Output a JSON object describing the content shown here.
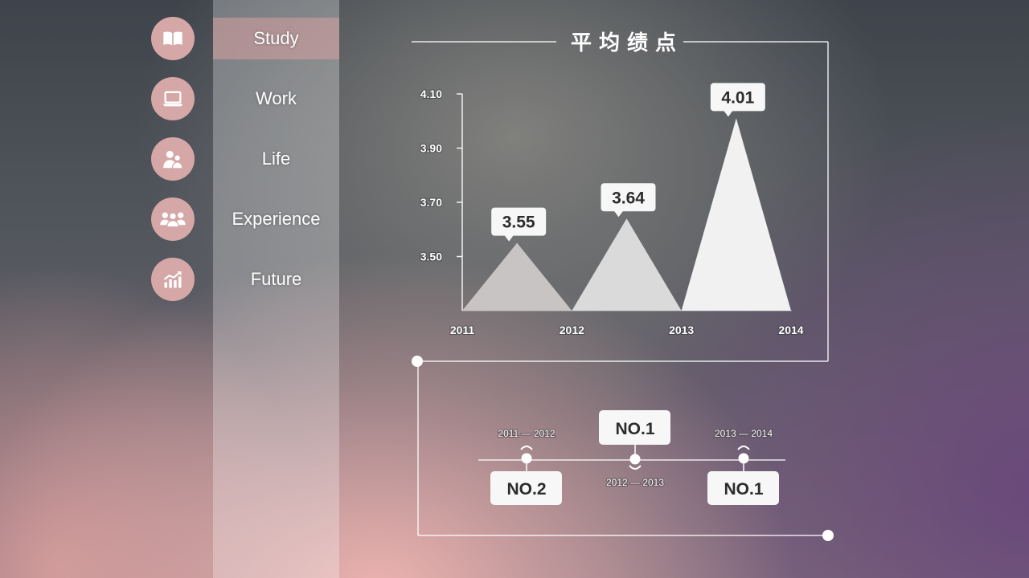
{
  "theme": {
    "accent": "#d5a7a6",
    "callout_fill": "#f7f7f7"
  },
  "nav": {
    "items": [
      {
        "label": "Study",
        "icon": "book-icon",
        "active": true
      },
      {
        "label": "Work",
        "icon": "laptop-icon",
        "active": false
      },
      {
        "label": "Life",
        "icon": "users-icon",
        "active": false
      },
      {
        "label": "Experience",
        "icon": "group-icon",
        "active": false
      },
      {
        "label": "Future",
        "icon": "growth-chart-icon",
        "active": false
      }
    ]
  },
  "chart_data": {
    "type": "bar",
    "title": "平均绩点",
    "x_tick_labels": [
      "2011",
      "2012",
      "2013",
      "2014"
    ],
    "y_tick_labels": [
      "4.10",
      "3.90",
      "3.70",
      "3.50"
    ],
    "xlim": [
      2011,
      2014
    ],
    "ylim": [
      3.3,
      4.1
    ],
    "grid": false,
    "series": [
      {
        "x_spans": [
          [
            2011,
            2012
          ],
          [
            2012,
            2013
          ],
          [
            2013,
            2014
          ]
        ],
        "values": [
          3.55,
          3.64,
          4.01
        ],
        "data_labels": [
          "3.55",
          "3.64",
          "4.01"
        ],
        "colors": [
          "#c8c4c3",
          "#dadada",
          "#f1f1f1"
        ]
      }
    ]
  },
  "timeline": {
    "items": [
      {
        "period": "2011 — 2012",
        "rank": "NO.2"
      },
      {
        "period": "2012 — 2013",
        "rank": "NO.1"
      },
      {
        "period": "2013 — 2014",
        "rank": "NO.1"
      }
    ]
  }
}
